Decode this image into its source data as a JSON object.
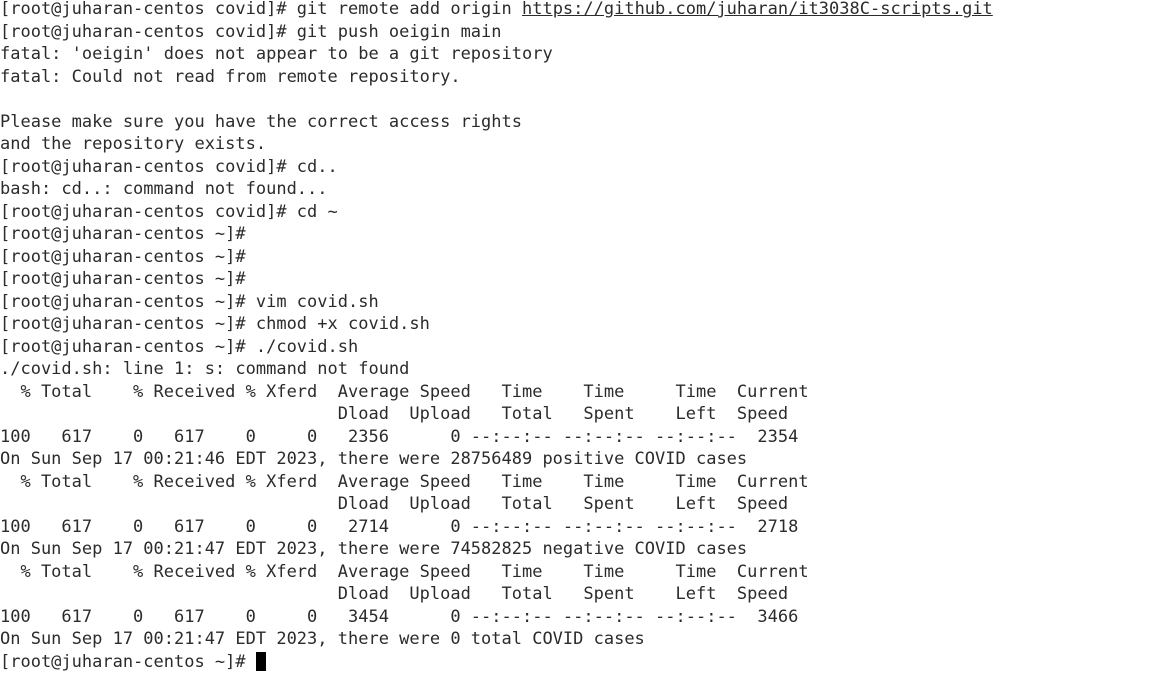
{
  "terminal": {
    "lines": [
      {
        "text": "[root@juharan-centos covid]# git remote add origin ",
        "link": "https://github.com/juharan/it3038C-scripts.git"
      },
      {
        "text": "[root@juharan-centos covid]# git push oeigin main"
      },
      {
        "text": "fatal: 'oeigin' does not appear to be a git repository"
      },
      {
        "text": "fatal: Could not read from remote repository."
      },
      {
        "text": ""
      },
      {
        "text": "Please make sure you have the correct access rights"
      },
      {
        "text": "and the repository exists."
      },
      {
        "text": "[root@juharan-centos covid]# cd.."
      },
      {
        "text": "bash: cd..: command not found..."
      },
      {
        "text": "[root@juharan-centos covid]# cd ~"
      },
      {
        "text": "[root@juharan-centos ~]#"
      },
      {
        "text": "[root@juharan-centos ~]#"
      },
      {
        "text": "[root@juharan-centos ~]#"
      },
      {
        "text": "[root@juharan-centos ~]# vim covid.sh"
      },
      {
        "text": "[root@juharan-centos ~]# chmod +x covid.sh"
      },
      {
        "text": "[root@juharan-centos ~]# ./covid.sh"
      },
      {
        "text": "./covid.sh: line 1: s: command not found"
      },
      {
        "text": "  % Total    % Received % Xferd  Average Speed   Time    Time     Time  Current"
      },
      {
        "text": "                                 Dload  Upload   Total   Spent    Left  Speed"
      },
      {
        "text": "100   617    0   617    0     0   2356      0 --:--:-- --:--:-- --:--:--  2354"
      },
      {
        "text": "On Sun Sep 17 00:21:46 EDT 2023, there were 28756489 positive COVID cases"
      },
      {
        "text": "  % Total    % Received % Xferd  Average Speed   Time    Time     Time  Current"
      },
      {
        "text": "                                 Dload  Upload   Total   Spent    Left  Speed"
      },
      {
        "text": "100   617    0   617    0     0   2714      0 --:--:-- --:--:-- --:--:--  2718"
      },
      {
        "text": "On Sun Sep 17 00:21:47 EDT 2023, there were 74582825 negative COVID cases"
      },
      {
        "text": "  % Total    % Received % Xferd  Average Speed   Time    Time     Time  Current"
      },
      {
        "text": "                                 Dload  Upload   Total   Spent    Left  Speed"
      },
      {
        "text": "100   617    0   617    0     0   3454      0 --:--:-- --:--:-- --:--:--  3466"
      },
      {
        "text": "On Sun Sep 17 00:21:47 EDT 2023, there were 0 total COVID cases"
      }
    ],
    "prompt": "[root@juharan-centos ~]# "
  },
  "colors": {
    "background": "#ffffff",
    "text": "#2b2b2b",
    "cursor": "#000000"
  }
}
